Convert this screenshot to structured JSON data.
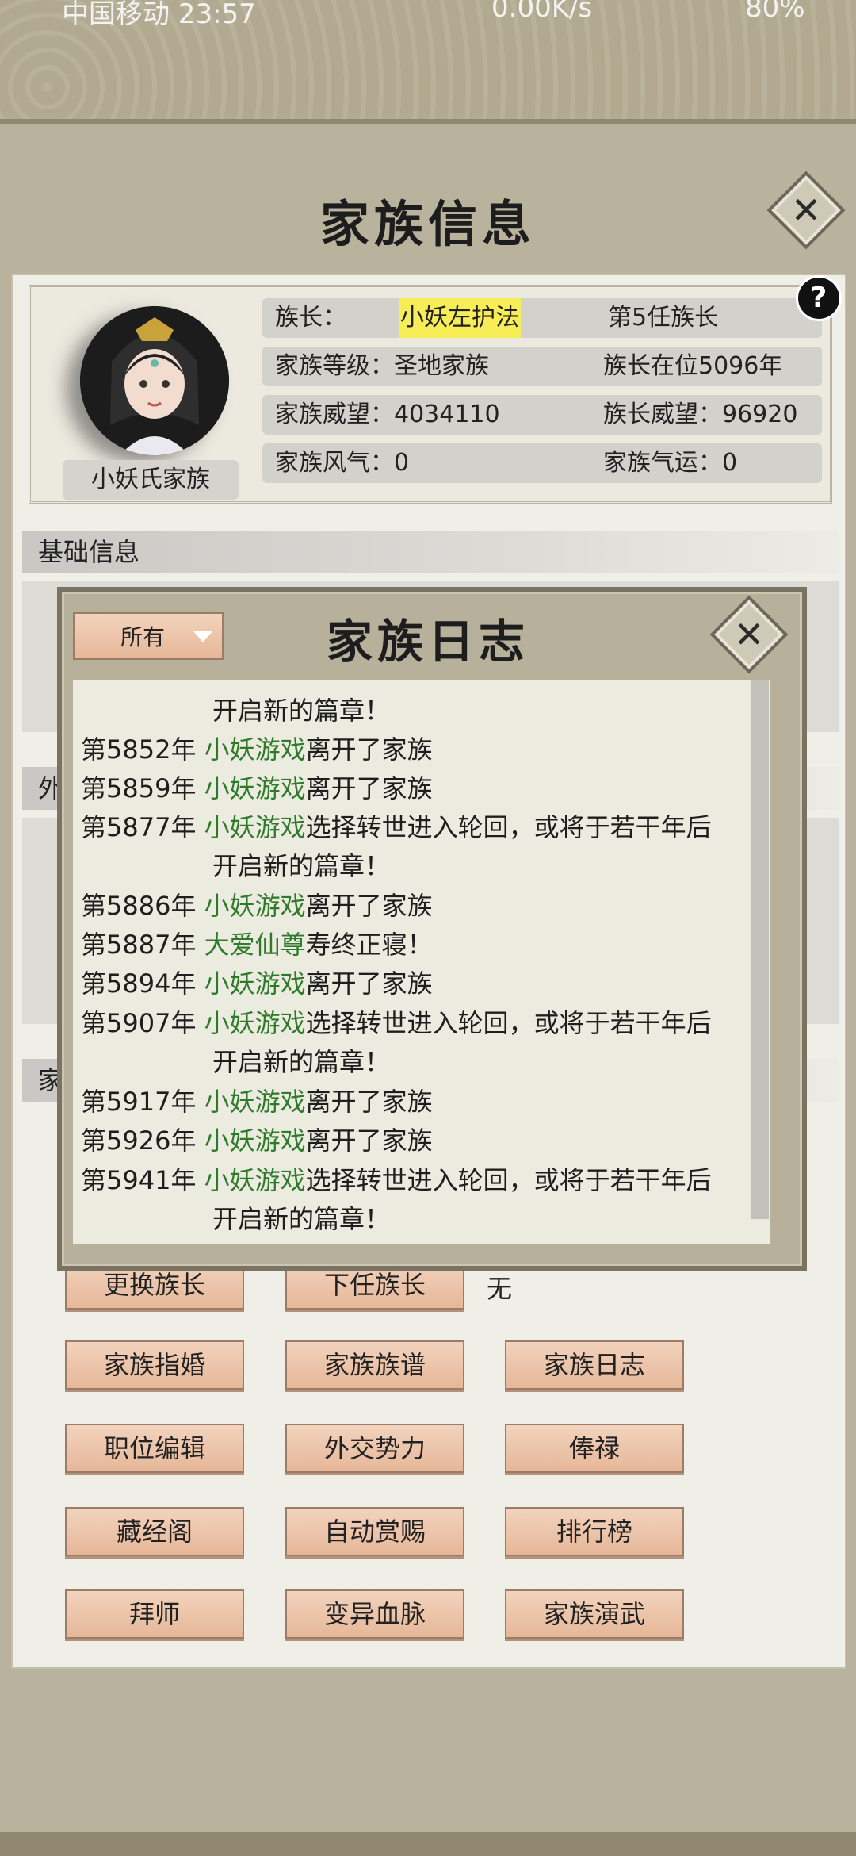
{
  "status_bar": {
    "carrier_time": "中国移动 23:57",
    "speed": "0.00K/s",
    "battery": "80%"
  },
  "header": {
    "title": "家族信息"
  },
  "family": {
    "name": "小妖氏家族",
    "leader_label": "族长：",
    "leader_name": "小妖左护法",
    "leader_term": "第5任族长",
    "level": "家族等级：圣地家族",
    "tenure": "族长在位5096年",
    "prestige": "家族威望：4034110",
    "leader_prestige": "族长威望：96920",
    "style": "家族风气：0",
    "fortune": "家族气运：0"
  },
  "help_label": "?",
  "sections": {
    "basic": "基础信息",
    "foreign": "外",
    "family": "家"
  },
  "actions": {
    "row1": [
      "更换族长",
      "下任族长"
    ],
    "successor_value": "无",
    "row2": [
      "家族指婚",
      "家族族谱",
      "家族日志"
    ],
    "row3": [
      "职位编辑",
      "外交势力",
      "俸禄"
    ],
    "row4": [
      "藏经阁",
      "自动赏赐",
      "排行榜"
    ],
    "row5": [
      "拜师",
      "变异血脉",
      "家族演武"
    ]
  },
  "log_dialog": {
    "title": "家族日志",
    "filter_value": "所有",
    "entries": [
      {
        "cont": "开启新的篇章！"
      },
      {
        "year": "第5852年",
        "name": "小妖游戏",
        "text": "离开了家族"
      },
      {
        "year": "第5859年",
        "name": "小妖游戏",
        "text": "离开了家族"
      },
      {
        "year": "第5877年",
        "name": "小妖游戏",
        "text": "选择转世进入轮回，或将于若干年后",
        "cont": "开启新的篇章！"
      },
      {
        "year": "第5886年",
        "name": "小妖游戏",
        "text": "离开了家族"
      },
      {
        "year": "第5887年",
        "name": "大爱仙尊",
        "text": "寿终正寝！"
      },
      {
        "year": "第5894年",
        "name": "小妖游戏",
        "text": "离开了家族"
      },
      {
        "year": "第5907年",
        "name": "小妖游戏",
        "text": "选择转世进入轮回，或将于若干年后",
        "cont": "开启新的篇章！"
      },
      {
        "year": "第5917年",
        "name": "小妖游戏",
        "text": "离开了家族"
      },
      {
        "year": "第5926年",
        "name": "小妖游戏",
        "text": "离开了家族"
      },
      {
        "year": "第5941年",
        "name": "小妖游戏",
        "text": "选择转世进入轮回，或将于若干年后",
        "cont": "开启新的篇章！"
      }
    ]
  },
  "colors": {
    "highlight": "#f7ee57",
    "green_name": "#2f7a2a",
    "button": "#e6b798"
  }
}
